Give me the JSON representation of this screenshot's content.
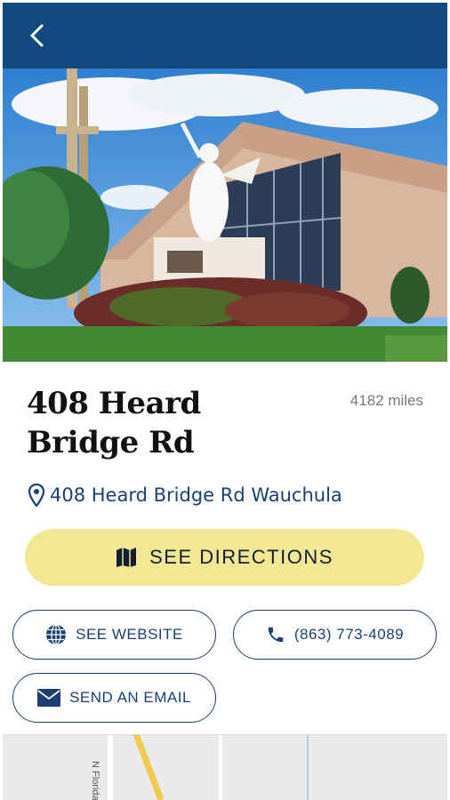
{
  "header": {
    "back_icon": "chevron-left-icon",
    "bg_color": "#124a80"
  },
  "location": {
    "title": "408 Heard Bridge Rd",
    "distance": "4182 miles",
    "address": "408 Heard Bridge Rd Wauchula"
  },
  "actions": {
    "directions_label": "SEE DIRECTIONS",
    "website_label": "SEE WEBSITE",
    "phone_label": "(863) 773-4089",
    "email_label": "SEND AN EMAIL"
  },
  "map": {
    "road_label": "N Florida"
  },
  "colors": {
    "accent": "#1b3f73",
    "directions_bg": "#f2e894"
  }
}
